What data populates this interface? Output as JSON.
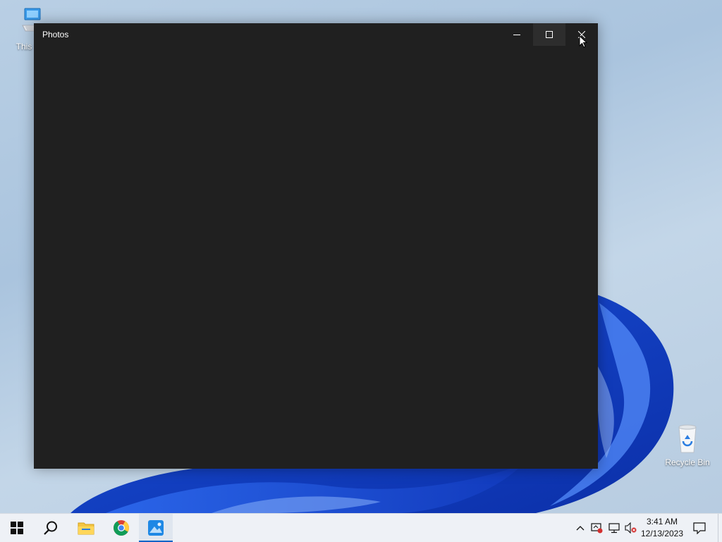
{
  "desktop": {
    "icons": [
      {
        "label": "This PC",
        "icon": "this-pc-icon"
      },
      {
        "label": "Recycle Bin",
        "icon": "recycle-bin-icon"
      }
    ]
  },
  "window": {
    "title": "Photos",
    "controls": {
      "minimize": "minimize-icon",
      "maximize": "maximize-icon",
      "close": "close-icon"
    }
  },
  "taskbar": {
    "items": [
      {
        "name": "start",
        "icon": "windows-logo-icon"
      },
      {
        "name": "search",
        "icon": "search-icon"
      },
      {
        "name": "file-explorer",
        "icon": "folder-icon"
      },
      {
        "name": "chrome",
        "icon": "chrome-icon"
      },
      {
        "name": "photos",
        "icon": "photos-icon",
        "active": true
      }
    ],
    "tray": {
      "icons": [
        "chevron-up-icon",
        "security-warning-icon",
        "network-icon",
        "volume-muted-icon"
      ],
      "time": "3:41 AM",
      "date": "12/13/2023",
      "notification_icon": "notification-icon"
    }
  },
  "colors": {
    "accent": "#0a64c8",
    "window_bg": "#202020"
  }
}
